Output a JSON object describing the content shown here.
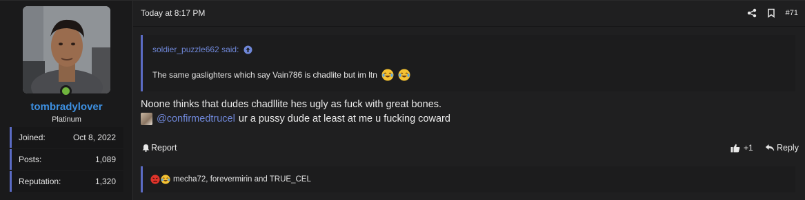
{
  "user": {
    "username": "tombradylover",
    "title": "Platinum",
    "stats": [
      {
        "label": "Joined:",
        "value": "Oct 8, 2022"
      },
      {
        "label": "Posts:",
        "value": "1,089"
      },
      {
        "label": "Reputation:",
        "value": "1,320"
      }
    ]
  },
  "post": {
    "date": "Today at 8:17 PM",
    "number": "#71",
    "quote": {
      "attribution": "soldier_puzzle662 said:",
      "text": "The same gaslighters which say Vain786 is chadlite but im ltn"
    },
    "body_line1": "Noone thinks that dudes chadllite hes ugly as fuck with great bones.",
    "mention": "@confirmedtrucel",
    "body_line2_rest": "ur a pussy dude at least at me u fucking coward",
    "actions": {
      "report": "Report",
      "react_count": "+1",
      "reply": "Reply"
    },
    "reactions_users": "mecha72, forevermirin and TRUE_CEL"
  },
  "colors": {
    "accent": "#5b6bc4",
    "link": "#6f87d8",
    "username": "#3d8fe0",
    "online": "#6fb43d"
  },
  "icons": [
    "share-icon",
    "bookmark-icon",
    "up-arrow-icon",
    "joy-emoji-icon",
    "bell-icon",
    "thumbs-up-icon",
    "reply-icon",
    "angry-emoji-icon"
  ]
}
